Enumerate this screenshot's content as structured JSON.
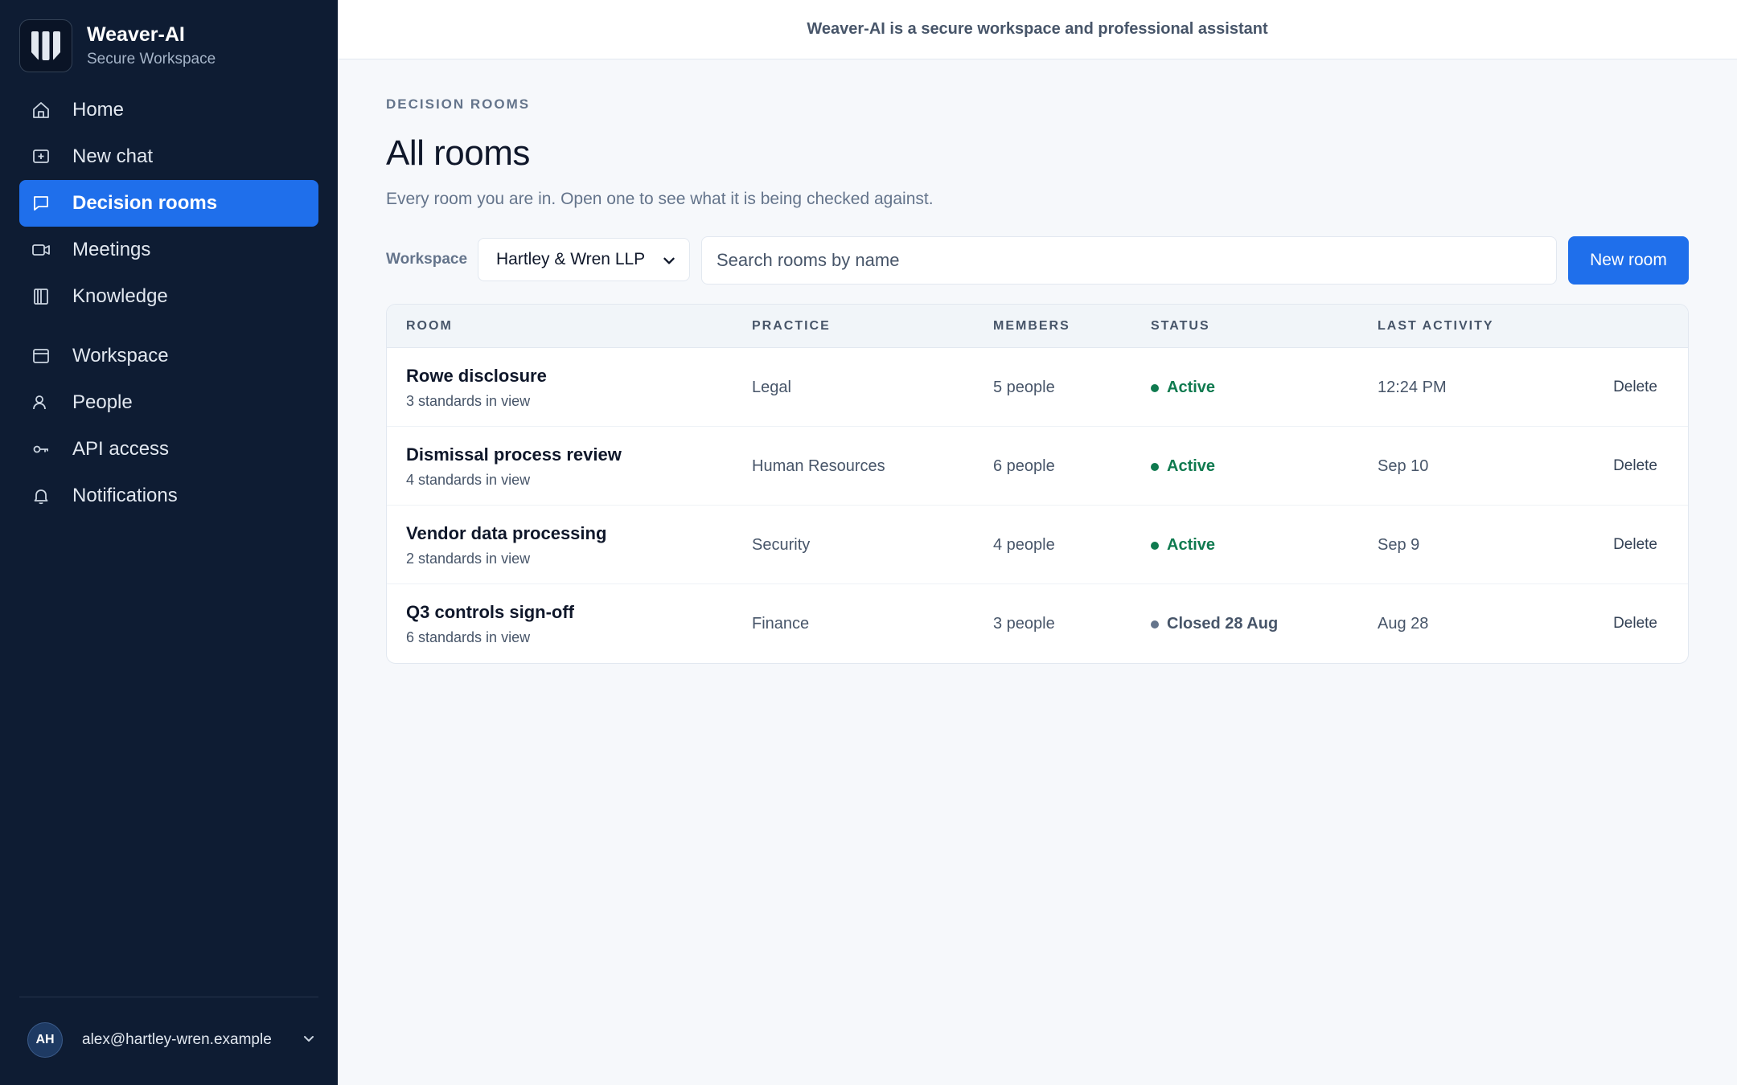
{
  "app": {
    "name": "Weaver-AI",
    "subtitle": "Secure Workspace",
    "banner": "Weaver-AI is a secure workspace and professional assistant"
  },
  "sidebar": {
    "items": [
      {
        "label": "Home",
        "icon": "home-icon"
      },
      {
        "label": "New chat",
        "icon": "plus-square-icon"
      },
      {
        "label": "Decision rooms",
        "icon": "chat-bubble-icon",
        "active": true
      },
      {
        "label": "Meetings",
        "icon": "video-camera-icon"
      },
      {
        "label": "Knowledge",
        "icon": "book-icon"
      },
      {
        "label": "Workspace",
        "icon": "browser-window-icon"
      },
      {
        "label": "People",
        "icon": "person-icon"
      },
      {
        "label": "API access",
        "icon": "key-icon"
      },
      {
        "label": "Notifications",
        "icon": "bell-icon"
      }
    ]
  },
  "user": {
    "initials": "AH",
    "email": "alex@hartley-wren.example"
  },
  "page": {
    "eyebrow": "DECISION ROOMS",
    "title": "All rooms",
    "subtitle": "Every room you are in. Open one to see what it is being checked against."
  },
  "filters": {
    "workspace_label": "Workspace",
    "workspace_value": "Hartley & Wren LLP",
    "search_placeholder": "Search rooms by name",
    "new_room_label": "New room"
  },
  "table": {
    "headers": {
      "room": "ROOM",
      "practice": "PRACTICE",
      "members": "MEMBERS",
      "status": "STATUS",
      "last_activity": "LAST ACTIVITY"
    },
    "delete_label": "Delete",
    "rows": [
      {
        "name": "Rowe disclosure",
        "standards": "3 standards in view",
        "practice": "Legal",
        "members": "5 people",
        "status": "Active",
        "last_activity": "12:24 PM"
      },
      {
        "name": "Dismissal process review",
        "standards": "4 standards in view",
        "practice": "Human Resources",
        "members": "6 people",
        "status": "Active",
        "last_activity": "Sep 10"
      },
      {
        "name": "Vendor data processing",
        "standards": "2 standards in view",
        "practice": "Security",
        "members": "4 people",
        "status": "Active",
        "last_activity": "Sep 9"
      },
      {
        "name": "Q3 controls sign-off",
        "standards": "6 standards in view",
        "practice": "Finance",
        "members": "3 people",
        "status": "Closed 28 Aug",
        "last_activity": "Aug 28"
      }
    ]
  },
  "colors": {
    "sidebar_bg": "#0e1c33",
    "accent": "#1f6feb",
    "active_status": "#0f7a4f",
    "closed_status": "#64748b"
  }
}
